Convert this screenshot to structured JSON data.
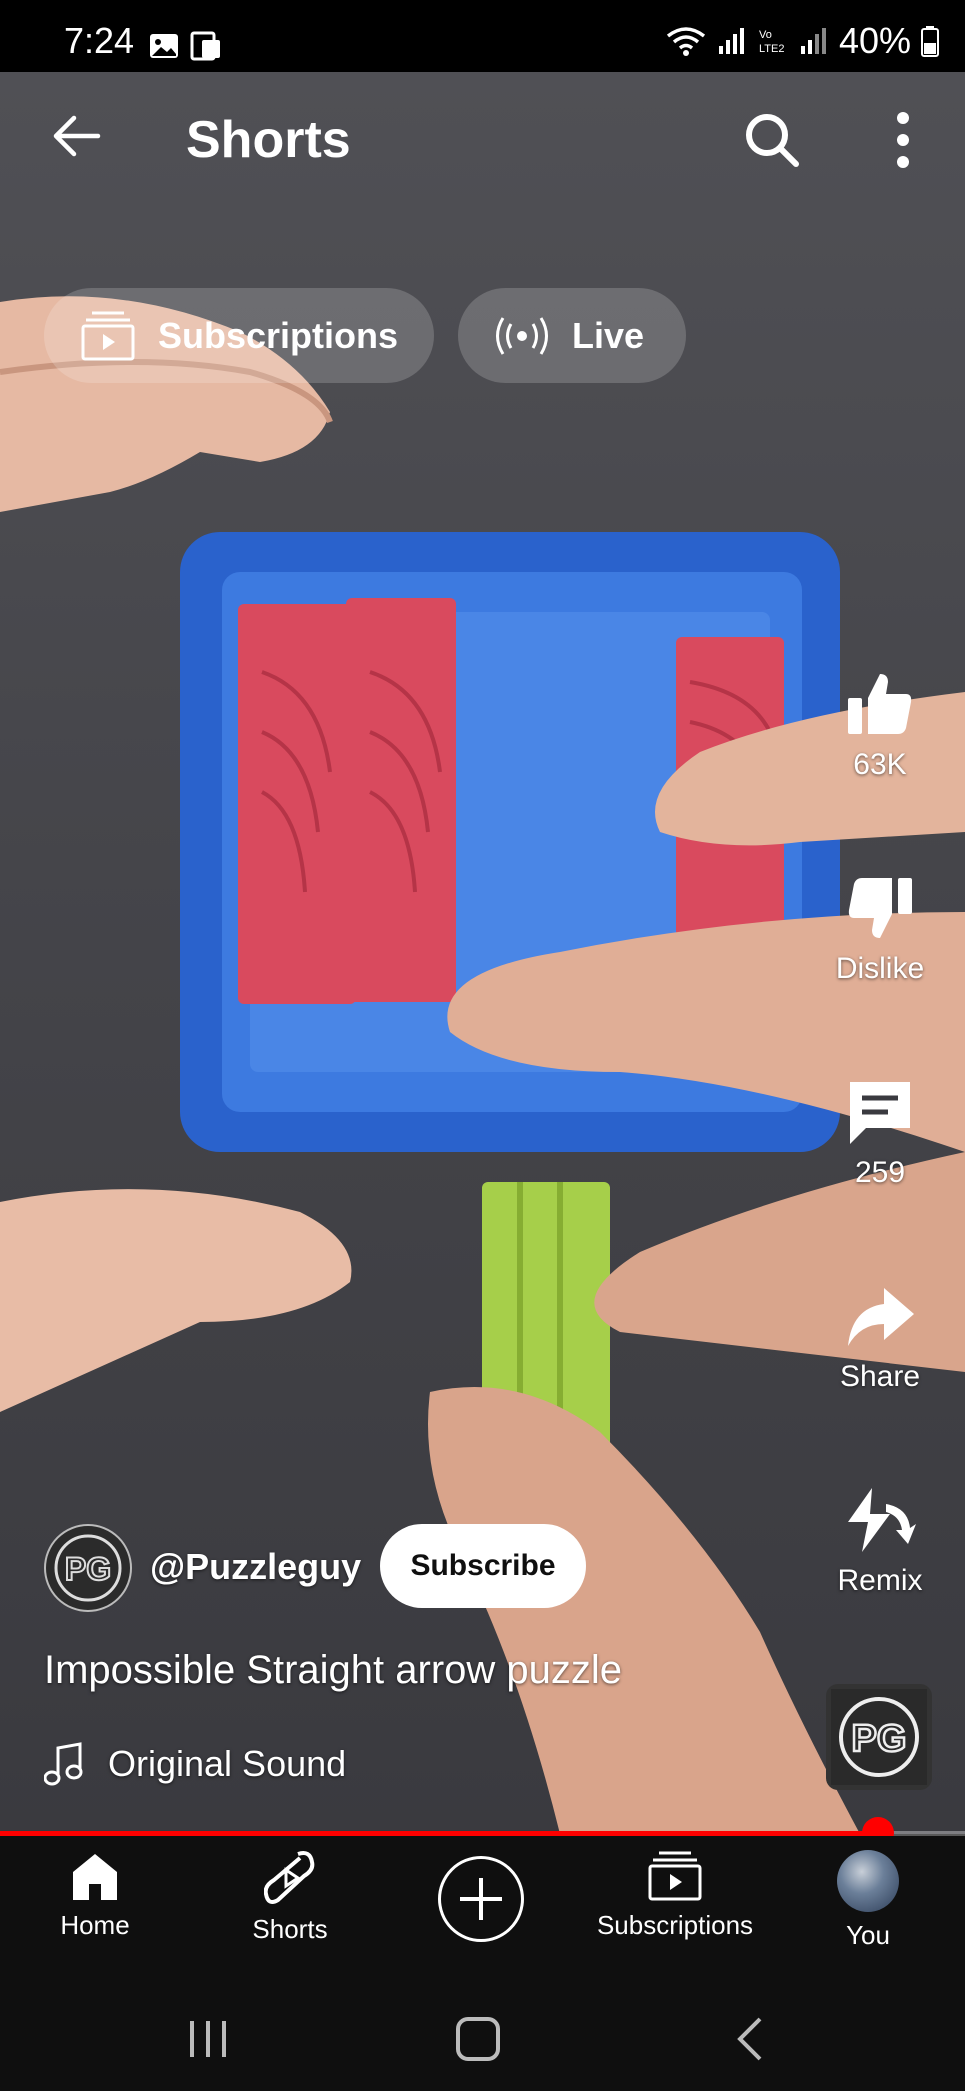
{
  "status_bar": {
    "time": "7:24",
    "battery": "40%",
    "icons": [
      "gallery-icon",
      "cast-icon",
      "wifi-icon",
      "signal-icon",
      "volte-icon",
      "signal-icon",
      "battery-icon"
    ]
  },
  "header": {
    "title": "Shorts",
    "back_icon": "arrow-left-icon",
    "search_icon": "search-icon",
    "more_icon": "more-vert-icon"
  },
  "chips": {
    "subscriptions": "Subscriptions",
    "live": "Live"
  },
  "actions": {
    "like_count": "63K",
    "dislike_label": "Dislike",
    "comments_count": "259",
    "share_label": "Share",
    "remix_label": "Remix"
  },
  "video": {
    "channel_handle": "@Puzzleguy",
    "subscribe_label": "Subscribe",
    "title": "Impossible Straight arrow puzzle",
    "sound": "Original Sound",
    "progress": 0.91
  },
  "bottom_nav": {
    "home": "Home",
    "shorts": "Shorts",
    "subscriptions": "Subscriptions",
    "you": "You"
  },
  "colors": {
    "accent": "#ff0000",
    "nav_bg": "#0f0f0f",
    "puzzle_blue": "#2f6fd6",
    "puzzle_red": "#d94a5e",
    "puzzle_green": "#a6cf4a"
  }
}
